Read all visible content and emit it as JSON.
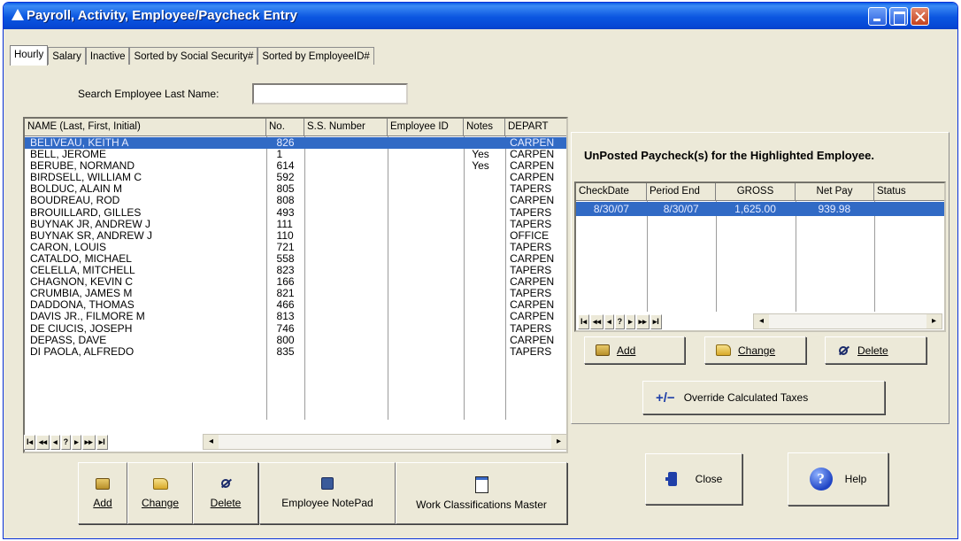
{
  "window": {
    "title": "Payroll, Activity, Employee/Paycheck Entry"
  },
  "tabs": [
    "Hourly",
    "Salary",
    "Inactive",
    "Sorted by Social Security#",
    "Sorted by EmployeeID#"
  ],
  "search": {
    "label": "Search Employee Last Name:",
    "value": ""
  },
  "employee_grid": {
    "columns": [
      "NAME (Last, First, Initial)",
      "No.",
      "S.S. Number",
      "Employee ID",
      "Notes",
      "DEPART"
    ],
    "rows": [
      {
        "name": "BELIVEAU, KEITH A",
        "no": "826",
        "ssn": "",
        "empid": "",
        "notes": "",
        "dept": "CARPEN"
      },
      {
        "name": "BELL, JEROME",
        "no": "1",
        "ssn": "",
        "empid": "",
        "notes": "Yes",
        "dept": "CARPEN"
      },
      {
        "name": "BERUBE, NORMAND",
        "no": "614",
        "ssn": "",
        "empid": "",
        "notes": "Yes",
        "dept": "CARPEN"
      },
      {
        "name": "BIRDSELL, WILLIAM C",
        "no": "592",
        "ssn": "",
        "empid": "",
        "notes": "",
        "dept": "CARPEN"
      },
      {
        "name": "BOLDUC, ALAIN M",
        "no": "805",
        "ssn": "",
        "empid": "",
        "notes": "",
        "dept": "TAPERS"
      },
      {
        "name": "BOUDREAU, ROD",
        "no": "808",
        "ssn": "",
        "empid": "",
        "notes": "",
        "dept": "CARPEN"
      },
      {
        "name": "BROUILLARD, GILLES",
        "no": "493",
        "ssn": "",
        "empid": "",
        "notes": "",
        "dept": "TAPERS"
      },
      {
        "name": "BUYNAK JR, ANDREW J",
        "no": "111",
        "ssn": "",
        "empid": "",
        "notes": "",
        "dept": "TAPERS"
      },
      {
        "name": "BUYNAK SR, ANDREW J",
        "no": "110",
        "ssn": "",
        "empid": "",
        "notes": "",
        "dept": "OFFICE"
      },
      {
        "name": "CARON, LOUIS",
        "no": "721",
        "ssn": "",
        "empid": "",
        "notes": "",
        "dept": "TAPERS"
      },
      {
        "name": "CATALDO, MICHAEL",
        "no": "558",
        "ssn": "",
        "empid": "",
        "notes": "",
        "dept": "CARPEN"
      },
      {
        "name": "CELELLA, MITCHELL",
        "no": "823",
        "ssn": "",
        "empid": "",
        "notes": "",
        "dept": "TAPERS"
      },
      {
        "name": "CHAGNON, KEVIN C",
        "no": "166",
        "ssn": "",
        "empid": "",
        "notes": "",
        "dept": "CARPEN"
      },
      {
        "name": "CRUMBIA, JAMES M",
        "no": "821",
        "ssn": "",
        "empid": "",
        "notes": "",
        "dept": "TAPERS"
      },
      {
        "name": "DADDONA, THOMAS",
        "no": "466",
        "ssn": "",
        "empid": "",
        "notes": "",
        "dept": "CARPEN"
      },
      {
        "name": "DAVIS JR., FILMORE M",
        "no": "813",
        "ssn": "",
        "empid": "",
        "notes": "",
        "dept": "CARPEN"
      },
      {
        "name": "DE CIUCIS, JOSEPH",
        "no": "746",
        "ssn": "",
        "empid": "",
        "notes": "",
        "dept": "TAPERS"
      },
      {
        "name": "DEPASS, DAVE",
        "no": "800",
        "ssn": "",
        "empid": "",
        "notes": "",
        "dept": "CARPEN"
      },
      {
        "name": "DI PAOLA, ALFREDO",
        "no": "835",
        "ssn": "",
        "empid": "",
        "notes": "",
        "dept": "TAPERS"
      }
    ],
    "selected_index": 0
  },
  "record_nav": {
    "buttons": [
      "I◂",
      "◂◂",
      "◂",
      "?",
      "▸",
      "▸▸",
      "▸I"
    ]
  },
  "paycheck_panel": {
    "title": "UnPosted Paycheck(s) for the Highlighted Employee.",
    "columns": [
      "CheckDate",
      "Period End",
      "GROSS",
      "Net Pay",
      "Status"
    ],
    "rows": [
      {
        "checkdate": "8/30/07",
        "period_end": "8/30/07",
        "gross": "1,625.00",
        "net_pay": "939.98",
        "status": ""
      }
    ],
    "buttons": {
      "add": "Add",
      "change": "Change",
      "delete": "Delete",
      "override": "Override Calculated Taxes",
      "override_glyph": "+/−"
    }
  },
  "bottom_buttons": {
    "add": "Add",
    "change": "Change",
    "delete": "Delete",
    "notepad": "Employee NotePad",
    "workclass": "Work Classifications Master"
  },
  "dialog_buttons": {
    "close": "Close",
    "help": "Help",
    "help_glyph": "?"
  },
  "colors": {
    "title_bar": "#0b56e0",
    "selection": "#316ac5",
    "face": "#ece9d8"
  }
}
